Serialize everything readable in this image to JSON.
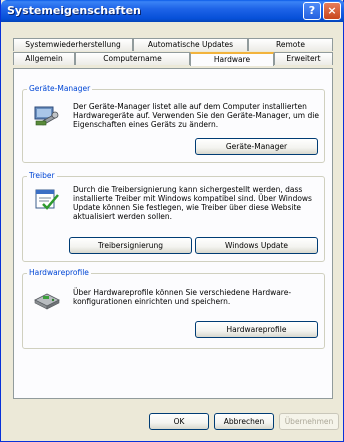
{
  "window": {
    "title": "Systemeigenschaften",
    "help_label": "?",
    "close_label": "×"
  },
  "tabs": {
    "row1": [
      "Systemwiederherstellung",
      "Automatische Updates",
      "Remote"
    ],
    "row2": [
      "Allgemein",
      "Computername",
      "Hardware",
      "Erweitert"
    ],
    "active": "Hardware"
  },
  "groups": {
    "device_manager": {
      "title": "Geräte-Manager",
      "text": "Der Geräte-Manager listet alle auf dem Computer installierten Hardwaregeräte auf. Verwenden Sie den Geräte-Manager, um die Eigenschaften eines Geräts zu ändern.",
      "button": "Geräte-Manager"
    },
    "drivers": {
      "title": "Treiber",
      "text": "Durch die Treibersignierung kann sichergestellt werden, dass installierte Treiber mit Windows kompatibel sind. Über Windows Update können Sie festlegen, wie Treiber über diese Website aktualisiert werden sollen.",
      "button_signing": "Treibersignierung",
      "button_update": "Windows Update"
    },
    "hardware_profiles": {
      "title": "Hardwareprofile",
      "text": "Über Hardwareprofile können Sie verschiedene Hardware-konfigurationen einrichten und speichern.",
      "button": "Hardwareprofile"
    }
  },
  "footer": {
    "ok": "OK",
    "cancel": "Abbrechen",
    "apply": "Übernehmen"
  }
}
